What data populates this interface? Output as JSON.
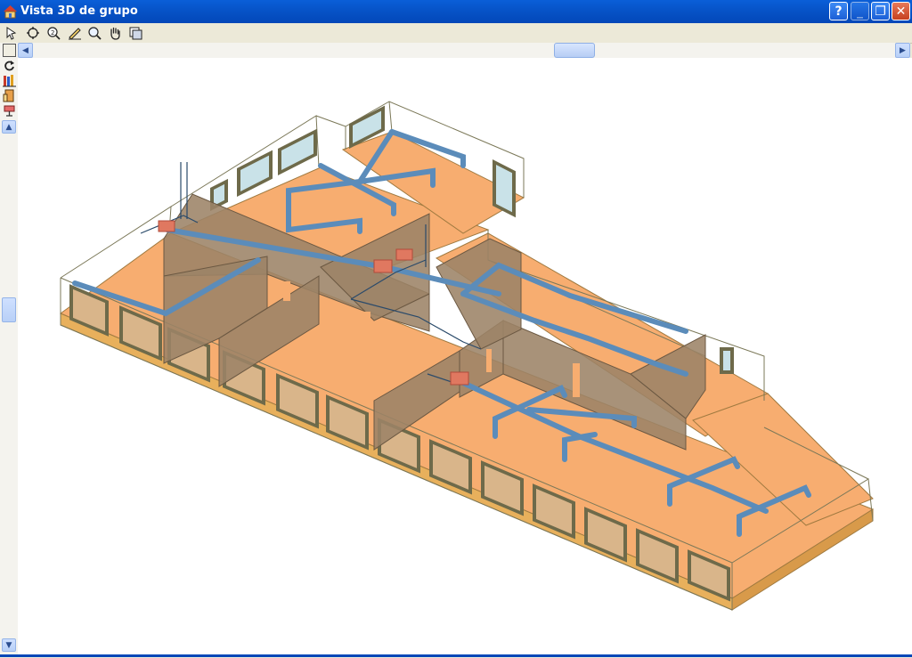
{
  "window": {
    "title": "Vista 3D de grupo",
    "buttons": {
      "help": "?",
      "minimize": "_",
      "restore": "❐",
      "close": "✕"
    }
  },
  "toolbar": {
    "tools": [
      "select-tool-icon",
      "orbit-zoom-icon",
      "zoom-window-icon",
      "draw-icon",
      "zoom-icon",
      "pan-hand-icon",
      "view-options-icon"
    ]
  },
  "left_tools": [
    "select-box-icon",
    "rotate-icon",
    "bookshelf-icon",
    "door-icon",
    "layer-icon",
    "scroll-up-icon"
  ],
  "scrollbar": {
    "left_arrow": "◀",
    "right_arrow": "▶",
    "up_arrow": "▲",
    "down_arrow": "▼"
  },
  "colors": {
    "floor": "#f7ad70",
    "wall": "#9c8366",
    "pipe": "#5b8cba",
    "frame": "#7b7858",
    "title_bar": "#0754c9"
  }
}
